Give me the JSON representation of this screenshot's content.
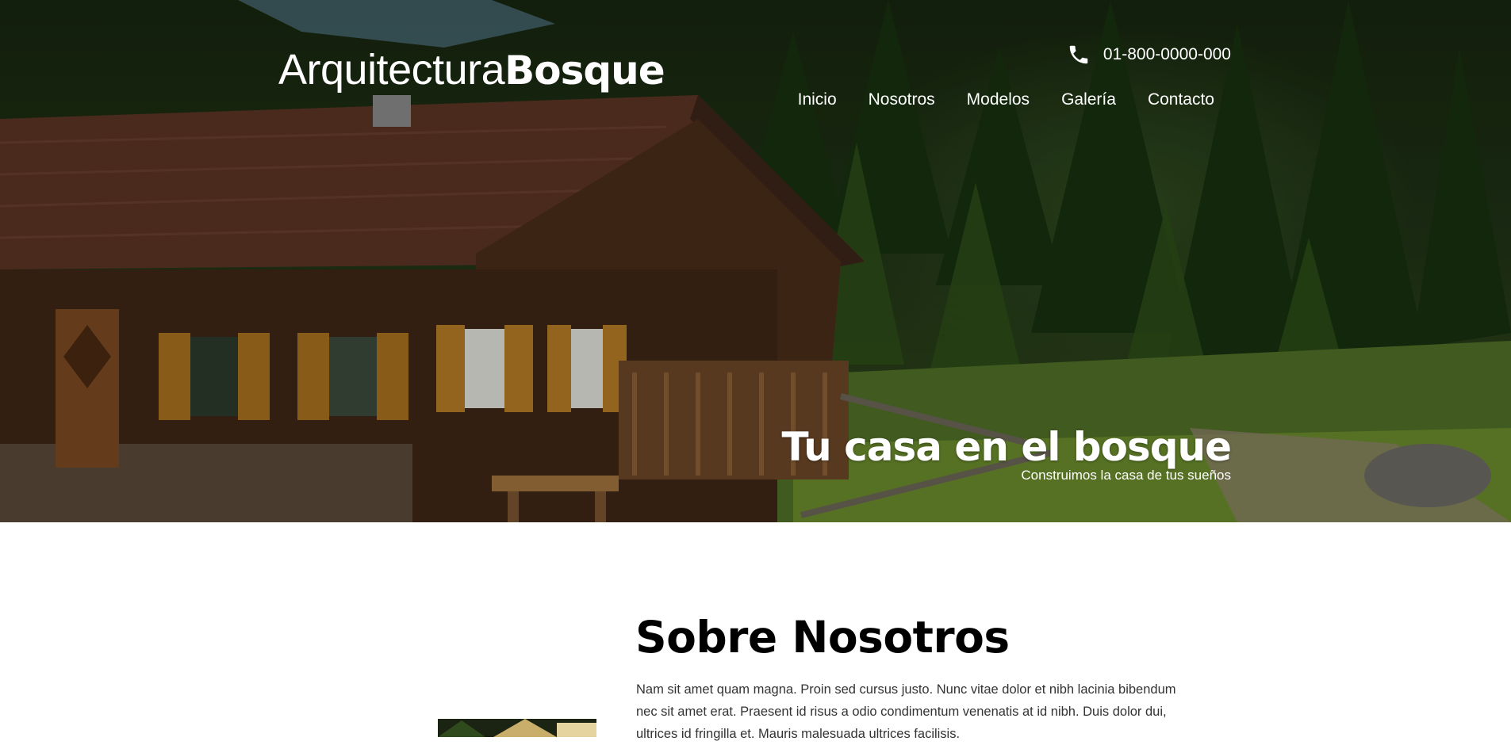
{
  "brand": {
    "light": "Arquitectura",
    "bold": "Bosque"
  },
  "contact": {
    "phone": "01-800-0000-000"
  },
  "nav": {
    "items": [
      {
        "label": "Inicio"
      },
      {
        "label": "Nosotros"
      },
      {
        "label": "Modelos"
      },
      {
        "label": "Galería"
      },
      {
        "label": "Contacto"
      }
    ]
  },
  "hero": {
    "title": "Tu casa en el bosque",
    "subtitle": "Construimos la casa de tus sueños"
  },
  "about": {
    "title": "Sobre Nosotros",
    "text": "Nam sit amet quam magna. Proin sed cursus justo. Nunc vitae dolor et nibh lacinia bibendum nec sit amet erat. Praesent id risus a odio condimentum venenatis at id nibh. Duis dolor dui, ultrices id fringilla et. Mauris malesuada ultrices facilisis."
  },
  "icons": {
    "phone": "phone-icon"
  },
  "colors": {
    "hero_text": "#ffffff",
    "body_text": "#333333",
    "heading": "#000000"
  }
}
